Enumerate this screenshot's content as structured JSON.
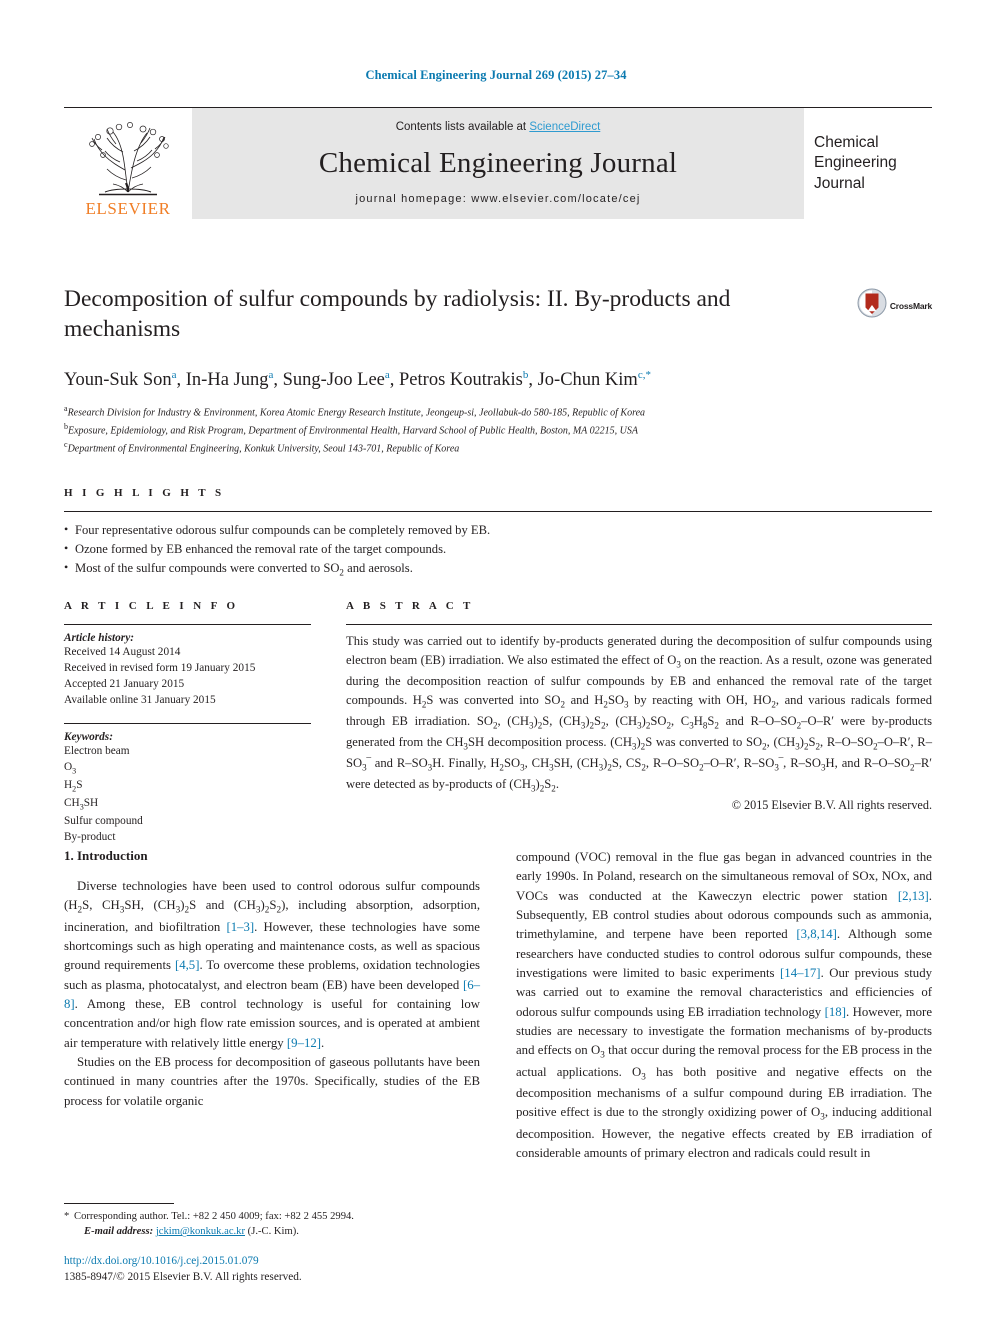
{
  "running_head": "Chemical Engineering Journal 269 (2015) 27–34",
  "masthead": {
    "publisher_name": "ELSEVIER",
    "publisher_logo_icon": "elsevier-tree-icon",
    "contents_prefix": "Contents lists available at ",
    "contents_link": "ScienceDirect",
    "journal_name": "Chemical Engineering Journal",
    "homepage": "journal homepage: www.elsevier.com/locate/cej",
    "cover_title_lines": [
      "Chemical",
      "Engineering",
      "Journal"
    ]
  },
  "article": {
    "title": "Decomposition of sulfur compounds by radiolysis: II. By-products and mechanisms",
    "crossmark_label": "CrossMark",
    "crossmark_icon": "crossmark-logo-icon",
    "authors": [
      {
        "name": "Youn-Suk Son",
        "marks": "a"
      },
      {
        "name": "In-Ha Jung",
        "marks": "a"
      },
      {
        "name": "Sung-Joo Lee",
        "marks": "a"
      },
      {
        "name": "Petros Koutrakis",
        "marks": "b"
      },
      {
        "name": "Jo-Chun Kim",
        "marks": "c,*"
      }
    ],
    "affiliations": [
      {
        "mark": "a",
        "text": "Research Division for Industry & Environment, Korea Atomic Energy Research Institute, Jeongeup-si, Jeollabuk-do 580-185, Republic of Korea"
      },
      {
        "mark": "b",
        "text": "Exposure, Epidemiology, and Risk Program, Department of Environmental Health, Harvard School of Public Health, Boston, MA 02215, USA"
      },
      {
        "mark": "c",
        "text": "Department of Environmental Engineering, Konkuk University, Seoul 143-701, Republic of Korea"
      }
    ]
  },
  "highlights": {
    "heading": "H I G H L I G H T S",
    "items": [
      "Four representative odorous sulfur compounds can be completely removed by EB.",
      "Ozone formed by EB enhanced the removal rate of the target compounds.",
      "Most of the sulfur compounds were converted to SO2 and aerosols."
    ]
  },
  "article_info": {
    "heading": "A R T I C L E   I N F O",
    "history_label": "Article history:",
    "history": [
      "Received 14 August 2014",
      "Received in revised form 19 January 2015",
      "Accepted 21 January 2015",
      "Available online 31 January 2015"
    ],
    "keywords_label": "Keywords:",
    "keywords": [
      "Electron beam",
      "O3",
      "H2S",
      "CH3SH",
      "Sulfur compound",
      "By-product"
    ]
  },
  "abstract": {
    "heading": "A B S T R A C T",
    "text": "This study was carried out to identify by-products generated during the decomposition of sulfur compounds using electron beam (EB) irradiation. We also estimated the effect of O3 on the reaction. As a result, ozone was generated during the decomposition reaction of sulfur compounds by EB and enhanced the removal rate of the target compounds. H2S was converted into SO2 and H2SO3 by reacting with OH, HO2, and various radicals formed through EB irradiation. SO2, (CH3)2S, (CH3)2S2, (CH3)2SO2, C3H8S2 and R–O–SO2–O–R′ were by-products generated from the CH3SH decomposition process. (CH3)2S was converted to SO2, (CH3)2S2, R–O–SO2–O–R′, R–SO3‾ and R–SO3H. Finally, H2SO3, CH3SH, (CH3)2S, CS2, R–O–SO2–O–R′, R–SO3‾, R–SO3H, and R–O–SO2–R′ were detected as by-products of (CH3)2S2.",
    "copyright": "© 2015 Elsevier B.V. All rights reserved."
  },
  "introduction": {
    "section_title": "1. Introduction",
    "left_paragraphs": [
      "Diverse technologies have been used to control odorous sulfur compounds (H2S, CH3SH, (CH3)2S and (CH3)2S2), including absorption, adsorption, incineration, and biofiltration [1–3]. However, these technologies have some shortcomings such as high operating and maintenance costs, as well as spacious ground requirements [4,5]. To overcome these problems, oxidation technologies such as plasma, photocatalyst, and electron beam (EB) have been developed [6–8]. Among these, EB control technology is useful for containing low concentration and/or high flow rate emission sources, and is operated at ambient air temperature with relatively little energy [9–12].",
      "Studies on the EB process for decomposition of gaseous pollutants have been continued in many countries after the 1970s. Specifically, studies of the EB process for volatile organic"
    ],
    "right_paragraphs": [
      "compound (VOC) removal in the flue gas began in advanced countries in the early 1990s. In Poland, research on the simultaneous removal of SOx, NOx, and VOCs was conducted at the Kaweczyn electric power station [2,13]. Subsequently, EB control studies about odorous compounds such as ammonia, trimethylamine, and terpene have been reported [3,8,14]. Although some researchers have conducted studies to control odorous sulfur compounds, these investigations were limited to basic experiments [14–17]. Our previous study was carried out to examine the removal characteristics and efficiencies of odorous sulfur compounds using EB irradiation technology [18]. However, more studies are necessary to investigate the formation mechanisms of by-products and effects on O3 that occur during the removal process for the EB process in the actual applications. O3 has both positive and negative effects on the decomposition mechanisms of a sulfur compound during EB irradiation. The positive effect is due to the strongly oxidizing power of O3, inducing additional decomposition. However, the negative effects created by EB irradiation of considerable amounts of primary electron and radicals could result in"
    ]
  },
  "footnote": {
    "star": "*",
    "corresponding": "Corresponding author. Tel.: +82 2 450 4009; fax: +82 2 455 2994.",
    "email_label": "E-mail address:",
    "email": "jckim@konkuk.ac.kr",
    "email_suffix": "(J.-C. Kim)."
  },
  "imprint": {
    "doi": "http://dx.doi.org/10.1016/j.cej.2015.01.079",
    "issn_copyright": "1385-8947/© 2015 Elsevier B.V. All rights reserved."
  },
  "colors": {
    "link_blue": "#0b7ab0",
    "science_direct_blue": "#2f9bd0",
    "elsevier_orange": "#f07e26",
    "masthead_gray": "#e6e6e6",
    "text": "#231f20"
  }
}
